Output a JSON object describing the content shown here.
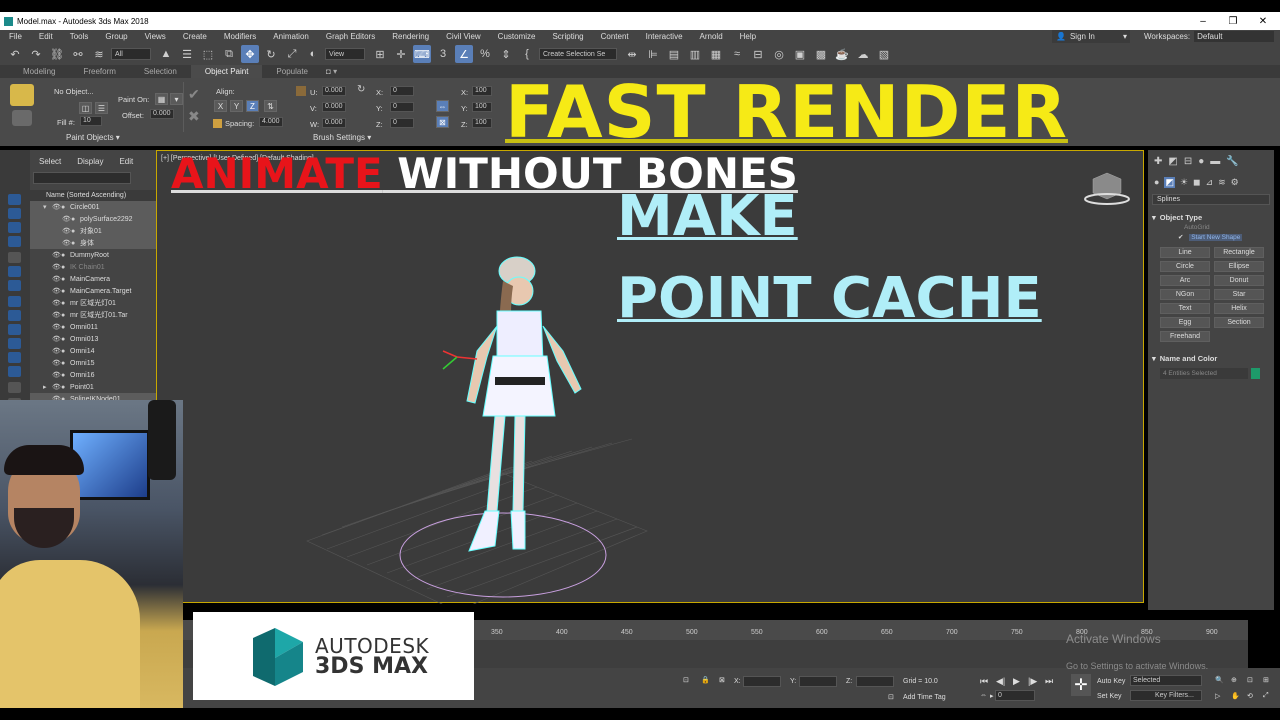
{
  "window": {
    "title": "Model.max - Autodesk 3ds Max 2018",
    "minimize": "–",
    "restore": "❐",
    "close": "✕"
  },
  "menu": [
    "File",
    "Edit",
    "Tools",
    "Group",
    "Views",
    "Create",
    "Modifiers",
    "Animation",
    "Graph Editors",
    "Rendering",
    "Civil View",
    "Customize",
    "Scripting",
    "Content",
    "Interactive",
    "Arnold",
    "Help"
  ],
  "signin": "Sign In",
  "workspaces_label": "Workspaces:",
  "workspaces_value": "Default",
  "toolbar": {
    "filter": "All",
    "refcoord": "View",
    "selection_set": "Create Selection Se"
  },
  "ribbon_tabs": [
    "Modeling",
    "Freeform",
    "Selection",
    "Object Paint",
    "Populate"
  ],
  "ribbon_selected": "Object Paint",
  "ribbon": {
    "no_object": "No Object...",
    "paint_on": "Paint On:",
    "offset_label": "Offset:",
    "offset_value": "0.000",
    "fill_label": "Fill #:",
    "fill_value": "10",
    "align_label": "Align:",
    "spacing_label": "Spacing:",
    "spacing_value": "4.000",
    "u_label": "U:",
    "u_value": "0.000",
    "v_label": "V:",
    "v_value": "0.000",
    "w_label": "W:",
    "w_value": "0.000",
    "x_label": "X:",
    "x_value": "0",
    "y_label": "Y:",
    "y_value": "0",
    "z_label": "Z:",
    "z_value": "0",
    "sx_label": "X:",
    "sx_value": "100",
    "sy_label": "Y:",
    "sy_value": "100",
    "sz_label": "Z:",
    "sz_value": "100",
    "axis_x": "X",
    "axis_y": "Y",
    "axis_z": "Z",
    "paint_objects": "Paint Objects ▾",
    "brush_settings": "Brush Settings ▾"
  },
  "overlay": {
    "fast_render": "FAST RENDER",
    "animate": "ANIMATE",
    "without_bones": " WITHOUT BONES",
    "make": "MAKE ",
    "point_cache": "POINT CACHE"
  },
  "explorer": {
    "tabs": [
      "Select",
      "Display",
      "Edit"
    ],
    "header": "Name (Sorted Ascending)",
    "rows": [
      {
        "name": "Circle001",
        "indent": 0,
        "hl": true,
        "dim": false
      },
      {
        "name": "polySurface2292",
        "indent": 1,
        "hl": true,
        "dim": false
      },
      {
        "name": "对象01",
        "indent": 1,
        "hl": true,
        "dim": false
      },
      {
        "name": "身体",
        "indent": 1,
        "hl": true,
        "dim": false
      },
      {
        "name": "DummyRoot",
        "indent": 0,
        "hl": false,
        "dim": false
      },
      {
        "name": "IK Chain01",
        "indent": 0,
        "hl": false,
        "dim": true
      },
      {
        "name": "MainCamera",
        "indent": 0,
        "hl": false,
        "dim": false
      },
      {
        "name": "MainCamera.Target",
        "indent": 0,
        "hl": false,
        "dim": false
      },
      {
        "name": "mr 区域光灯01",
        "indent": 0,
        "hl": false,
        "dim": false
      },
      {
        "name": "mr 区域光灯01.Tar",
        "indent": 0,
        "hl": false,
        "dim": false
      },
      {
        "name": "Omni011",
        "indent": 0,
        "hl": false,
        "dim": false
      },
      {
        "name": "Omni013",
        "indent": 0,
        "hl": false,
        "dim": false
      },
      {
        "name": "Omni14",
        "indent": 0,
        "hl": false,
        "dim": false
      },
      {
        "name": "Omni15",
        "indent": 0,
        "hl": false,
        "dim": false
      },
      {
        "name": "Omni16",
        "indent": 0,
        "hl": false,
        "dim": false
      },
      {
        "name": "Point01",
        "indent": 0,
        "hl": false,
        "dim": false
      },
      {
        "name": "SplineIKNode01",
        "indent": 0,
        "hl": true,
        "dim": false
      }
    ]
  },
  "viewport_label": "[+] [Perspective] [User Defined] [Default Shading]",
  "command_panel": {
    "category": "Splines",
    "object_type": "Object Type",
    "autogrid": "AutoGrid",
    "start_new_shape": "Start New Shape",
    "buttons": [
      "Line",
      "Rectangle",
      "Circle",
      "Ellipse",
      "Arc",
      "Donut",
      "NGon",
      "Star",
      "Text",
      "Helix",
      "Egg",
      "Section",
      "Freehand"
    ],
    "name_and_color": "Name and Color",
    "entities": "4 Entities Selected",
    "color": "#1e9a6a"
  },
  "timeline": {
    "ticks": [
      "350",
      "400",
      "450",
      "500",
      "550",
      "600",
      "650",
      "700",
      "750",
      "800",
      "850",
      "900"
    ]
  },
  "status": {
    "x_label": "X:",
    "y_label": "Y:",
    "z_label": "Z:",
    "grid": "Grid = 10.0",
    "add_time_tag": "Add Time Tag",
    "auto_key": "Auto Key",
    "selected": "Selected",
    "set_key": "Set Key",
    "key_filters": "Key Filters...",
    "frame": "0",
    "object": "obj"
  },
  "activate": {
    "title": "Activate Windows",
    "subtitle": "Go to Settings to activate Windows."
  },
  "logo": {
    "line1": "AUTODESK",
    "line2": "3DS MAX"
  }
}
